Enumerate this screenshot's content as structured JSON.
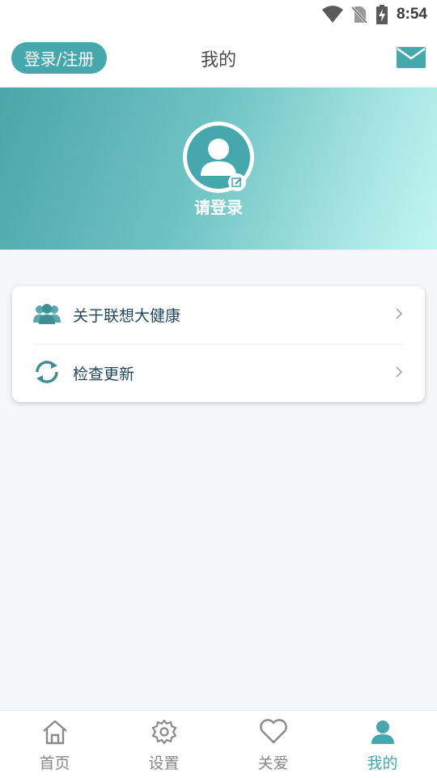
{
  "status_bar": {
    "time": "8:54"
  },
  "header": {
    "login_button": "登录/注册",
    "title": "我的"
  },
  "profile": {
    "prompt": "请登录"
  },
  "menu": {
    "items": [
      {
        "label": "关于联想大健康",
        "icon": "users-icon"
      },
      {
        "label": "检查更新",
        "icon": "refresh-icon"
      }
    ]
  },
  "tabbar": {
    "tabs": [
      {
        "label": "首页",
        "icon": "home-icon"
      },
      {
        "label": "设置",
        "icon": "gear-icon"
      },
      {
        "label": "关爱",
        "icon": "heart-icon"
      },
      {
        "label": "我的",
        "icon": "person-icon",
        "active": true
      }
    ]
  },
  "colors": {
    "accent": "#46a8ad",
    "text_dark": "#23465e",
    "background": "#f4f6f9"
  }
}
